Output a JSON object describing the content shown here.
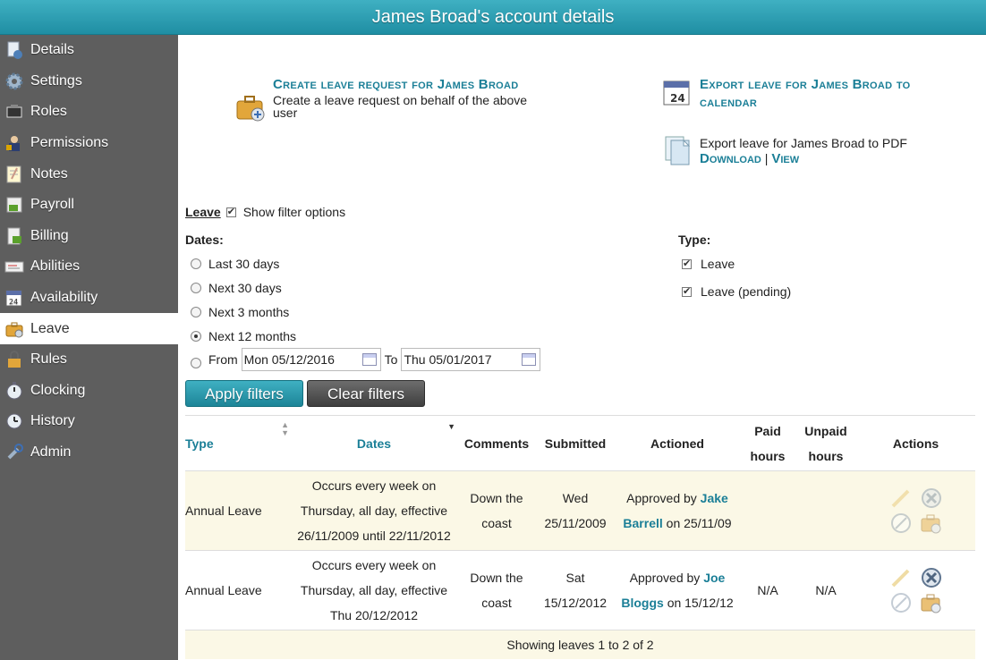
{
  "window": {
    "title": "James Broad's account details"
  },
  "sidebar": {
    "items": [
      {
        "label": "Details",
        "icon": "details-icon"
      },
      {
        "label": "Settings",
        "icon": "gear-icon"
      },
      {
        "label": "Roles",
        "icon": "roles-icon"
      },
      {
        "label": "Permissions",
        "icon": "permissions-icon"
      },
      {
        "label": "Notes",
        "icon": "notes-icon"
      },
      {
        "label": "Payroll",
        "icon": "payroll-icon"
      },
      {
        "label": "Billing",
        "icon": "billing-icon"
      },
      {
        "label": "Abilities",
        "icon": "abilities-icon"
      },
      {
        "label": "Availability",
        "icon": "calendar-icon"
      },
      {
        "label": "Leave",
        "icon": "briefcase-icon"
      },
      {
        "label": "Rules",
        "icon": "lock-icon"
      },
      {
        "label": "Clocking",
        "icon": "stopwatch-icon"
      },
      {
        "label": "History",
        "icon": "clock-icon"
      },
      {
        "label": "Admin",
        "icon": "wrench-icon"
      }
    ],
    "active_index": 9
  },
  "actions": {
    "create": {
      "title": "Create leave request for James Broad",
      "description": "Create a leave request on behalf of the above user"
    },
    "export_calendar": {
      "title": "Export leave for James Broad to calendar"
    },
    "export_pdf": {
      "description": "Export leave for James Broad to PDF",
      "download_label": "Download",
      "separator": "|",
      "view_label": "View"
    }
  },
  "filters": {
    "leave_label": "Leave",
    "show_filter_label": "Show filter options",
    "show_filter_checked": true,
    "dates_label": "Dates:",
    "date_options": [
      {
        "label": "Last 30 days",
        "checked": false
      },
      {
        "label": "Next 30 days",
        "checked": false
      },
      {
        "label": "Next 3 months",
        "checked": false
      },
      {
        "label": "Next 12 months",
        "checked": true
      },
      {
        "label": "From",
        "checked": false
      }
    ],
    "from_value": "Mon 05/12/2016",
    "to_label": "To",
    "to_value": "Thu 05/01/2017",
    "type_label": "Type:",
    "type_options": [
      {
        "label": "Leave",
        "checked": true
      },
      {
        "label": "Leave (pending)",
        "checked": true
      }
    ],
    "apply_label": "Apply filters",
    "clear_label": "Clear filters"
  },
  "table": {
    "headers": {
      "type": "Type",
      "dates": "Dates",
      "comments": "Comments",
      "submitted": "Submitted",
      "actioned": "Actioned",
      "paid": "Paid hours",
      "unpaid": "Unpaid hours",
      "actions": "Actions"
    },
    "rows": [
      {
        "type": "Annual Leave",
        "dates": "Occurs every week on Thursday, all day, effective 26/11/2009 until 22/11/2012",
        "comments": "Down the coast",
        "submitted": "Wed 25/11/2009",
        "actioned_prefix": "Approved by",
        "actioned_person": "Jake Barrell",
        "actioned_suffix": "on 25/11/09",
        "paid": "",
        "unpaid": ""
      },
      {
        "type": "Annual Leave",
        "dates": "Occurs every week on Thursday, all day, effective Thu 20/12/2012",
        "comments": "Down the coast",
        "submitted": "Sat 15/12/2012",
        "actioned_prefix": "Approved by",
        "actioned_person": "Joe Bloggs",
        "actioned_suffix": "on 15/12/12",
        "paid": "N/A",
        "unpaid": "N/A"
      }
    ],
    "footer": "Showing leaves 1 to 2 of 2"
  }
}
